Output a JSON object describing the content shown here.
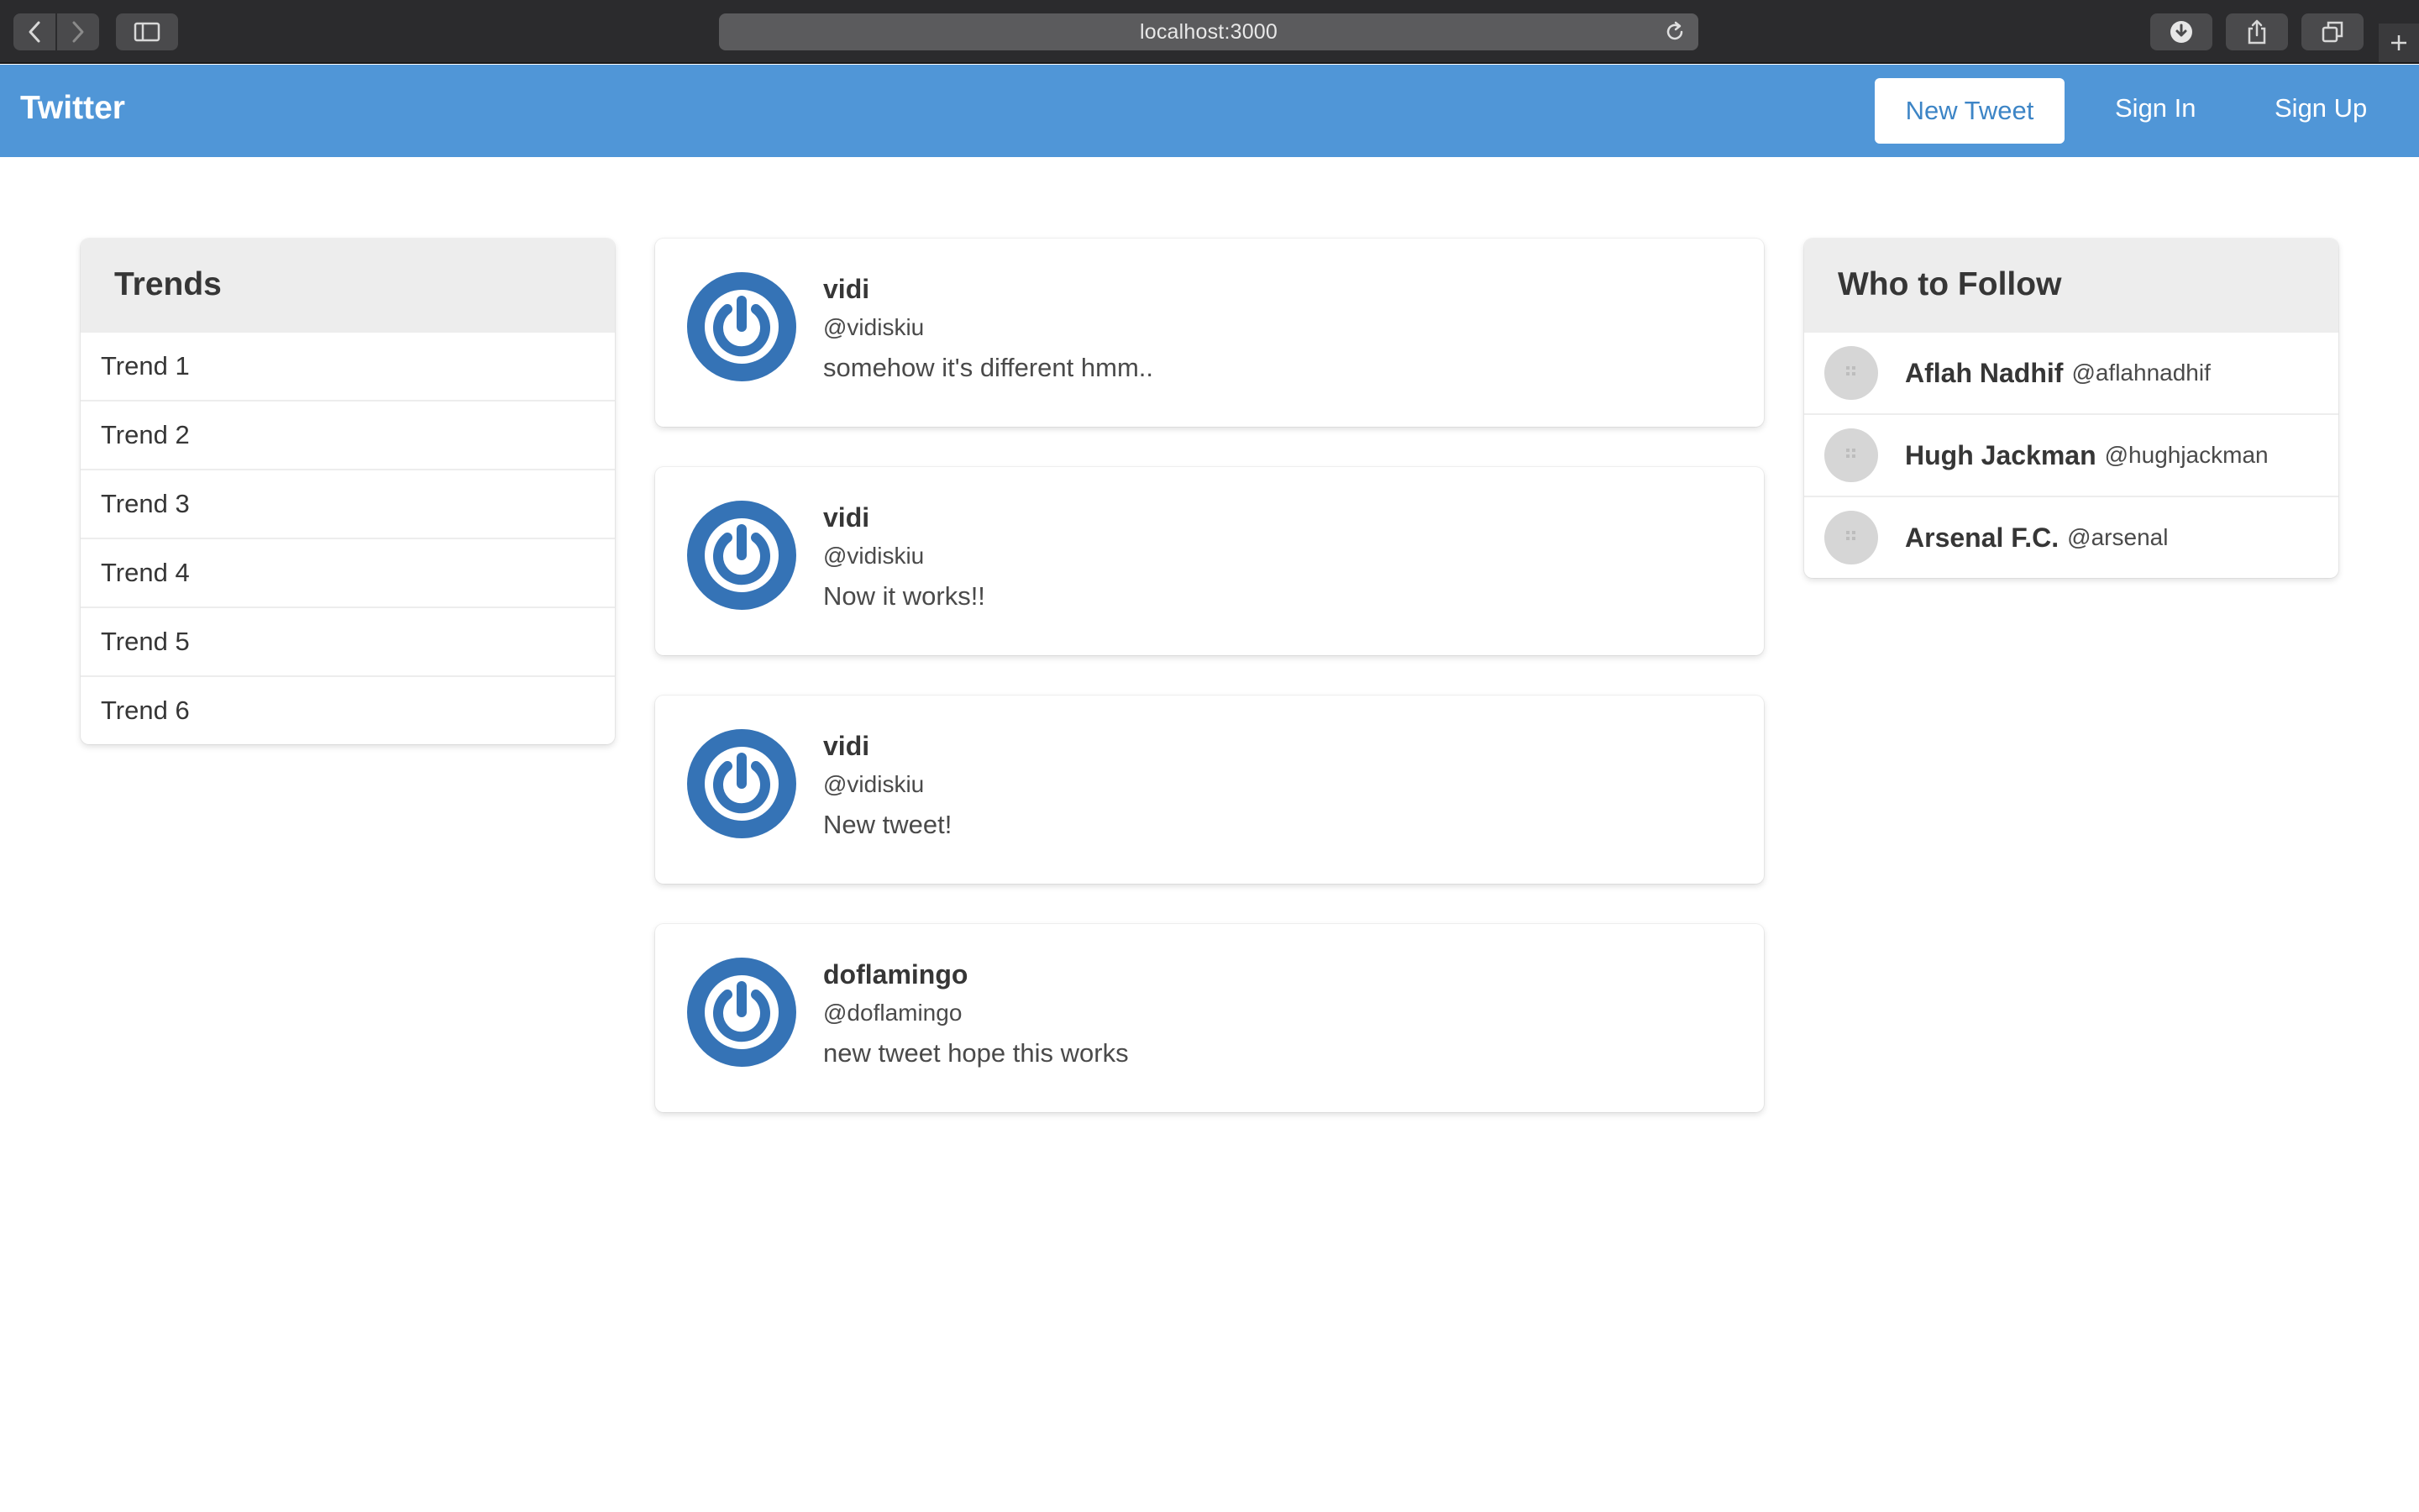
{
  "browser": {
    "url": "localhost:3000",
    "icons": [
      "back-icon",
      "forward-icon",
      "sidebar-icon",
      "reload-icon",
      "download-icon",
      "share-icon",
      "tabs-icon",
      "new-tab-icon"
    ]
  },
  "navbar": {
    "brand": "Twitter",
    "new_tweet_label": "New Tweet",
    "sign_in_label": "Sign In",
    "sign_up_label": "Sign Up",
    "color": "#5096d7"
  },
  "trends": {
    "title": "Trends",
    "items": [
      "Trend 1",
      "Trend 2",
      "Trend 3",
      "Trend 4",
      "Trend 5",
      "Trend 6"
    ]
  },
  "tweets": [
    {
      "name": "vidi",
      "handle": "@vidiskiu",
      "text": "somehow it's different hmm.."
    },
    {
      "name": "vidi",
      "handle": "@vidiskiu",
      "text": "Now it works!!"
    },
    {
      "name": "vidi",
      "handle": "@vidiskiu",
      "text": "New tweet!"
    },
    {
      "name": "doflamingo",
      "handle": "@doflamingo",
      "text": "new tweet hope this works"
    }
  ],
  "who_to_follow": {
    "title": "Who to Follow",
    "users": [
      {
        "name": "Aflah Nadhif",
        "handle": "@aflahnadhif"
      },
      {
        "name": "Hugh Jackman",
        "handle": "@hughjackman"
      },
      {
        "name": "Arsenal F.C.",
        "handle": "@arsenal"
      }
    ]
  }
}
